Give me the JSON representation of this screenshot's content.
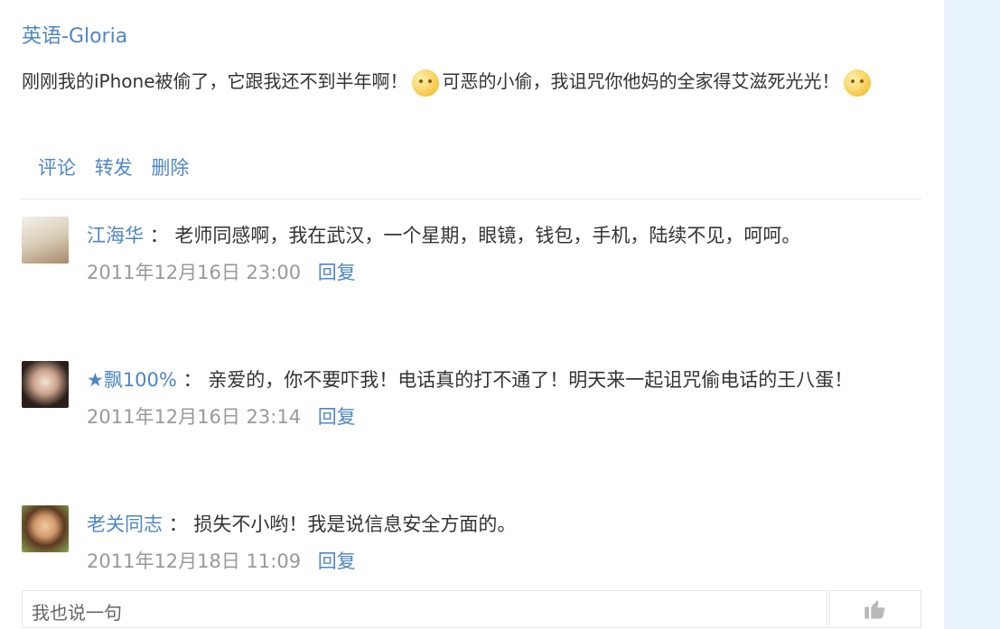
{
  "post": {
    "author": "英语-Gloria",
    "text_part1": "刚刚我的iPhone被偷了，它跟我还不到半年啊！",
    "emoji1": "sad-face-emoji",
    "text_part2": "可恶的小偷，我诅咒你他妈的全家得艾滋死光光！",
    "emoji2": "angry-face-emoji",
    "actions": {
      "comment": "评论",
      "forward": "转发",
      "delete": "删除"
    }
  },
  "comments": [
    {
      "name": "江海华",
      "separator": "：",
      "text": "老师同感啊，我在武汉，一个星期，眼镜，钱包，手机，陆续不见，呵呵。",
      "time": "2011年12月16日 23:00",
      "reply": "回复"
    },
    {
      "name": "★飘100%",
      "separator": "：",
      "text": "亲爱的，你不要吓我！电话真的打不通了！明天来一起诅咒偷电话的王八蛋！",
      "time": "2011年12月16日 23:14",
      "reply": "回复"
    },
    {
      "name": "老关同志",
      "separator": "：",
      "text": "损失不小哟！我是说信息安全方面的。",
      "time": "2011年12月18日 11:09",
      "reply": "回复"
    }
  ],
  "input": {
    "placeholder": "我也说一句"
  },
  "colors": {
    "link": "#4f86c6",
    "text": "#333333",
    "muted": "#999999",
    "side_panel": "#e7f2fb"
  },
  "icons": {
    "like": "thumbs-up-icon"
  }
}
